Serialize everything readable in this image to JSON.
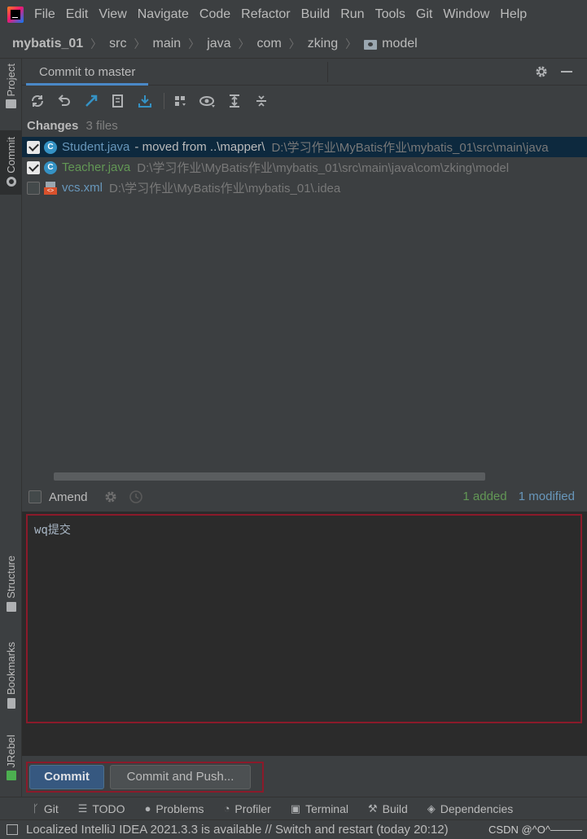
{
  "menu": [
    "File",
    "Edit",
    "View",
    "Navigate",
    "Code",
    "Refactor",
    "Build",
    "Run",
    "Tools",
    "Git",
    "Window",
    "Help"
  ],
  "breadcrumb": [
    "mybatis_01",
    "src",
    "main",
    "java",
    "com",
    "zking",
    "model"
  ],
  "left_tabs": {
    "project": "Project",
    "commit": "Commit",
    "structure": "Structure",
    "bookmarks": "Bookmarks",
    "jrebel": "JRebel"
  },
  "panel": {
    "title": "Commit to master"
  },
  "changes": {
    "title": "Changes",
    "count": "3 files"
  },
  "files": [
    {
      "name": "Student.java",
      "extra": "- moved from ..\\mapper\\",
      "path": "D:\\学习作业\\MyBatis作业\\mybatis_01\\src\\main\\java",
      "checked": true,
      "selected": true
    },
    {
      "name": "Teacher.java",
      "extra": "",
      "path": "D:\\学习作业\\MyBatis作业\\mybatis_01\\src\\main\\java\\com\\zking\\model",
      "checked": true,
      "selected": false
    },
    {
      "name": "vcs.xml",
      "extra": "",
      "path": "D:\\学习作业\\MyBatis作业\\mybatis_01\\.idea",
      "checked": false,
      "selected": false
    }
  ],
  "amend": {
    "label": "Amend",
    "added": "1 added",
    "modified": "1 modified"
  },
  "message": "wq提交",
  "buttons": {
    "commit": "Commit",
    "commit_push": "Commit and Push..."
  },
  "bottom_tools": [
    "Git",
    "TODO",
    "Problems",
    "Profiler",
    "Terminal",
    "Build",
    "Dependencies"
  ],
  "status": {
    "text": "Localized IntelliJ IDEA 2021.3.3 is available // Switch and restart (today 20:12)",
    "watermark": "CSDN @^O^———"
  },
  "colors": {
    "accent": "#4a88c7",
    "added": "#629755",
    "modified": "#6897bb",
    "highlight_frame": "#8b1a2a",
    "commit_button": "#365880"
  }
}
